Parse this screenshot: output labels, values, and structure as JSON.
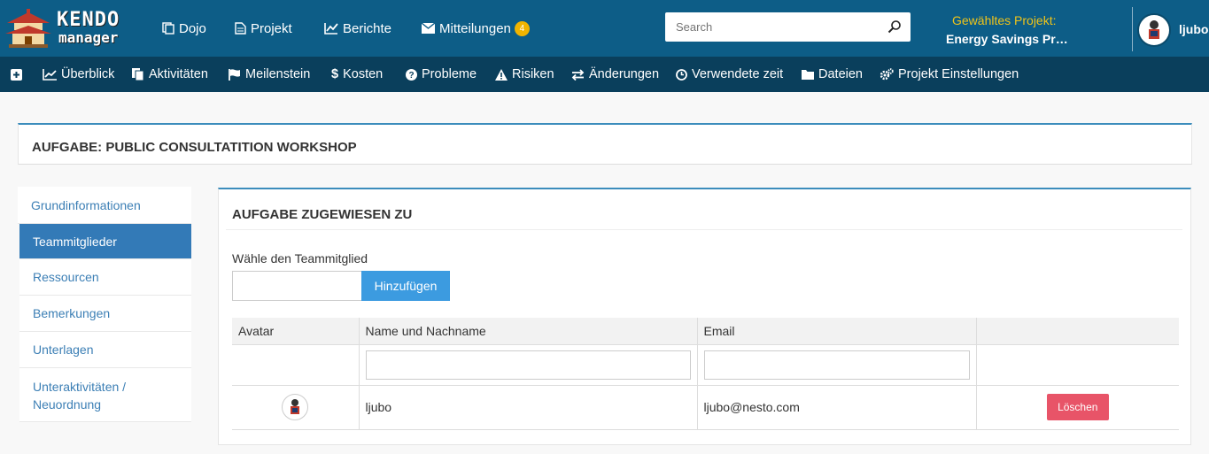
{
  "header": {
    "logo": {
      "line1": "KENDO",
      "line2": "manager"
    },
    "nav": [
      {
        "label": "Dojo",
        "icon": "copy-icon"
      },
      {
        "label": "Projekt",
        "icon": "file-icon"
      },
      {
        "label": "Berichte",
        "icon": "line-chart-icon"
      },
      {
        "label": "Mitteilungen",
        "icon": "envelope-icon",
        "badge": "4"
      }
    ],
    "search": {
      "placeholder": "Search",
      "value": ""
    },
    "project": {
      "label": "Gewähltes Projekt:",
      "name": "Energy Savings Pr…"
    },
    "user": {
      "name": "ljubo"
    }
  },
  "subnav": [
    {
      "label": "",
      "icon": "plus-square-icon"
    },
    {
      "label": "Überblick",
      "icon": "area-chart-icon"
    },
    {
      "label": "Aktivitäten",
      "icon": "files-icon"
    },
    {
      "label": "Meilenstein",
      "icon": "flag-icon"
    },
    {
      "label": "Kosten",
      "icon": "dollar-icon"
    },
    {
      "label": "Probleme",
      "icon": "question-circle-icon"
    },
    {
      "label": "Risiken",
      "icon": "warning-icon"
    },
    {
      "label": "Änderungen",
      "icon": "exchange-icon"
    },
    {
      "label": "Verwendete zeit",
      "icon": "clock-icon"
    },
    {
      "label": "Dateien",
      "icon": "folder-icon"
    },
    {
      "label": "Projekt Einstellungen",
      "icon": "cogs-icon"
    }
  ],
  "page_title": "AUFGABE: PUBLIC CONSULTATITION WORKSHOP",
  "sidemenu": [
    {
      "label": "Grundinformationen",
      "active": false
    },
    {
      "label": "Teammitglieder",
      "active": true
    },
    {
      "label": "Ressourcen",
      "active": false
    },
    {
      "label": "Bemerkungen",
      "active": false
    },
    {
      "label": "Unterlagen",
      "active": false
    },
    {
      "label": "Unteraktivitäten / Neuordnung",
      "active": false
    }
  ],
  "main": {
    "heading": "AUFGABE ZUGEWIESEN ZU",
    "choose_label": "Wähle den Teammitglied",
    "member_input_value": "",
    "add_button": "Hinzufügen",
    "table": {
      "columns": [
        "Avatar",
        "Name und Nachname",
        "Email",
        ""
      ],
      "filters": {
        "name": "",
        "email": ""
      },
      "rows": [
        {
          "name": "ljubo",
          "email": "ljubo@nesto.com",
          "action": "Löschen"
        }
      ]
    }
  },
  "colors": {
    "topbar": "#0d5d87",
    "subbar": "#0a3f5c",
    "accent": "#3c8dbc",
    "active_menu": "#337ab7",
    "add_button": "#3c9be0",
    "delete_button": "#e85468",
    "project_label": "#f0c419",
    "badge": "#f0b400"
  }
}
